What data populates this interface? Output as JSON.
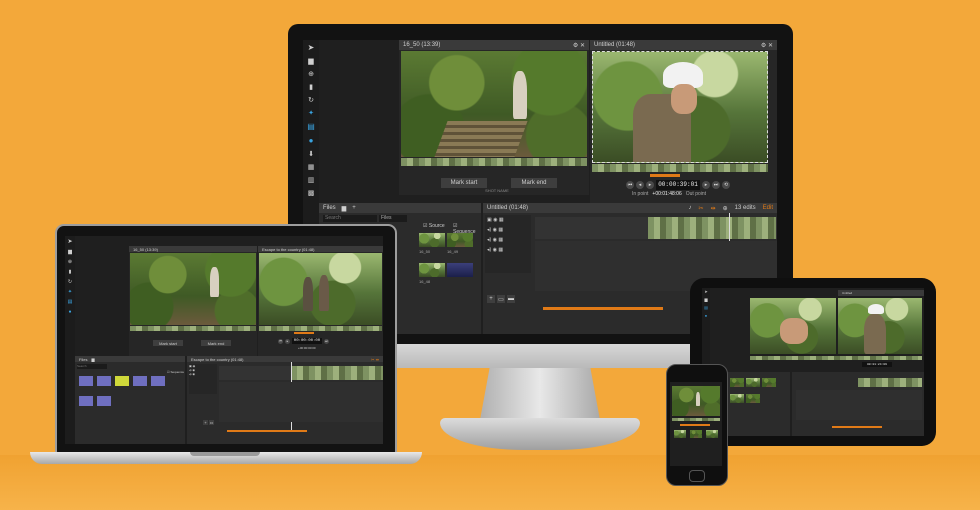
{
  "colors": {
    "background": "#f3a83a",
    "accent": "#e07a17",
    "ui_dark": "#1f1f1f",
    "selected": "#39a3e0"
  },
  "imac": {
    "sidebar_icons": [
      "logo-icon",
      "folder-icon",
      "plus-circle-icon",
      "trash-icon",
      "history-icon",
      "twitter-icon",
      "film-icon",
      "globe-icon",
      "download-icon",
      "gallery-icon",
      "chart-icon",
      "grid-icon"
    ],
    "source": {
      "title": "16_50 (13:39)",
      "mark_start": "Mark start",
      "mark_end": "Mark end",
      "shot_name": "SHOT NAME"
    },
    "program": {
      "title": "Untitled (01:48)",
      "timecode": "00:00:39:01",
      "offset": "+00:01:48:06",
      "in_label": "In point",
      "out_label": "Out point"
    },
    "files": {
      "title": "Files",
      "search": "Search",
      "filter": "Files",
      "source_label": "Source",
      "sequence_label": "Sequence",
      "thumb_labels": [
        "16_50",
        "16_49",
        "16_48"
      ]
    },
    "timeline": {
      "title": "Untitled (01:48)",
      "edits": "13 edits",
      "edit_label": "Edit"
    }
  },
  "macbook": {
    "source": {
      "title": "16_50 (13:39)",
      "mark_start": "Mark start",
      "mark_end": "Mark end"
    },
    "program": {
      "title": "Escape to the country (01:48)",
      "timecode": "00:00:00:00",
      "offset": "+00:00:00:00"
    },
    "files": {
      "title": "Files",
      "search": "Search",
      "sequence_label": "Sequence"
    },
    "timeline": {
      "title": "Escape to the country (01:48)"
    }
  },
  "tablet": {
    "program_title": "Untitled",
    "timecode": "00:01:24:09"
  },
  "phone": {}
}
